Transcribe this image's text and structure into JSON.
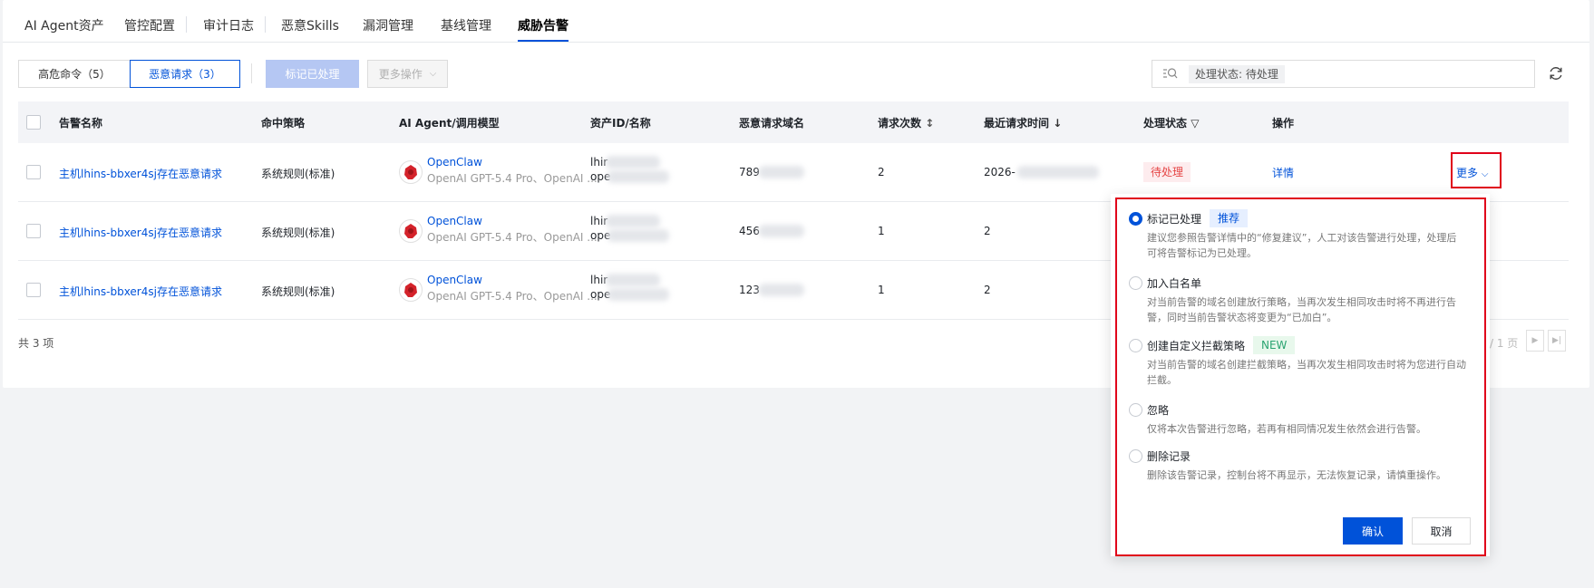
{
  "tabs": [
    {
      "label": "AI Agent资产",
      "active": false
    },
    {
      "label": "管控配置",
      "active": false
    },
    {
      "label": "审计日志",
      "active": false
    },
    {
      "label": "恶意Skills",
      "active": false
    },
    {
      "label": "漏洞管理",
      "active": false
    },
    {
      "label": "基线管理",
      "active": false
    },
    {
      "label": "威胁告警",
      "active": true
    }
  ],
  "toolbar": {
    "seg_high_risk": "高危命令（5）",
    "seg_malicious": "恶意请求（3）",
    "mark_handled": "标记已处理",
    "more_ops": "更多操作",
    "search_chip": "处理状态: 待处理"
  },
  "table": {
    "headers": {
      "name": "告警名称",
      "policy": "命中策略",
      "agent": "AI Agent/调用模型",
      "asset": "资产ID/名称",
      "domain": "恶意请求域名",
      "count": "请求次数",
      "time": "最近请求时间",
      "status": "处理状态",
      "ops": "操作"
    },
    "rows": [
      {
        "name": "主机lhins-bbxer4sj存在恶意请求",
        "policy": "系统规则(标准)",
        "agent": "OpenClaw",
        "model": "OpenAI GPT-5.4 Pro、OpenAI ...",
        "asset1": "lhir",
        "asset2": "ope",
        "domain": "789",
        "count": "2",
        "time": "2026-",
        "status": "待处理",
        "detail": "详情",
        "more": "更多"
      },
      {
        "name": "主机lhins-bbxer4sj存在恶意请求",
        "policy": "系统规则(标准)",
        "agent": "OpenClaw",
        "model": "OpenAI GPT-5.4 Pro、OpenAI ...",
        "asset1": "lhir",
        "asset2": "ope",
        "domain": "456",
        "count": "1",
        "time": "2"
      },
      {
        "name": "主机lhins-bbxer4sj存在恶意请求",
        "policy": "系统规则(标准)",
        "agent": "OpenClaw",
        "model": "OpenAI GPT-5.4 Pro、OpenAI ...",
        "asset1": "lhir",
        "asset2": "ope",
        "domain": "123",
        "count": "1",
        "time": "2"
      }
    ],
    "total": "共 3 项",
    "pager_text": "/ 1 页"
  },
  "popover": {
    "options": [
      {
        "title": "标记已处理",
        "tag": "推荐",
        "desc": "建议您参照告警详情中的“修复建议”，人工对该告警进行处理，处理后可将告警标记为已处理。",
        "selected": true
      },
      {
        "title": "加入白名单",
        "desc": "对当前告警的域名创建放行策略，当再次发生相同攻击时将不再进行告警，同时当前告警状态将变更为“已加白”。"
      },
      {
        "title": "创建自定义拦截策略",
        "tag": "NEW",
        "desc": "对当前告警的域名创建拦截策略，当再次发生相同攻击时将为您进行自动拦截。"
      },
      {
        "title": "忽略",
        "desc": "仅将本次告警进行忽略，若再有相同情况发生依然会进行告警。"
      },
      {
        "title": "删除记录",
        "desc": "删除该告警记录，控制台将不再显示，无法恢复记录，请慎重操作。"
      }
    ],
    "confirm": "确认",
    "cancel": "取消"
  },
  "colors": {
    "primary": "#0052d9",
    "danger": "#e54545",
    "highlight": "#e0001a"
  }
}
